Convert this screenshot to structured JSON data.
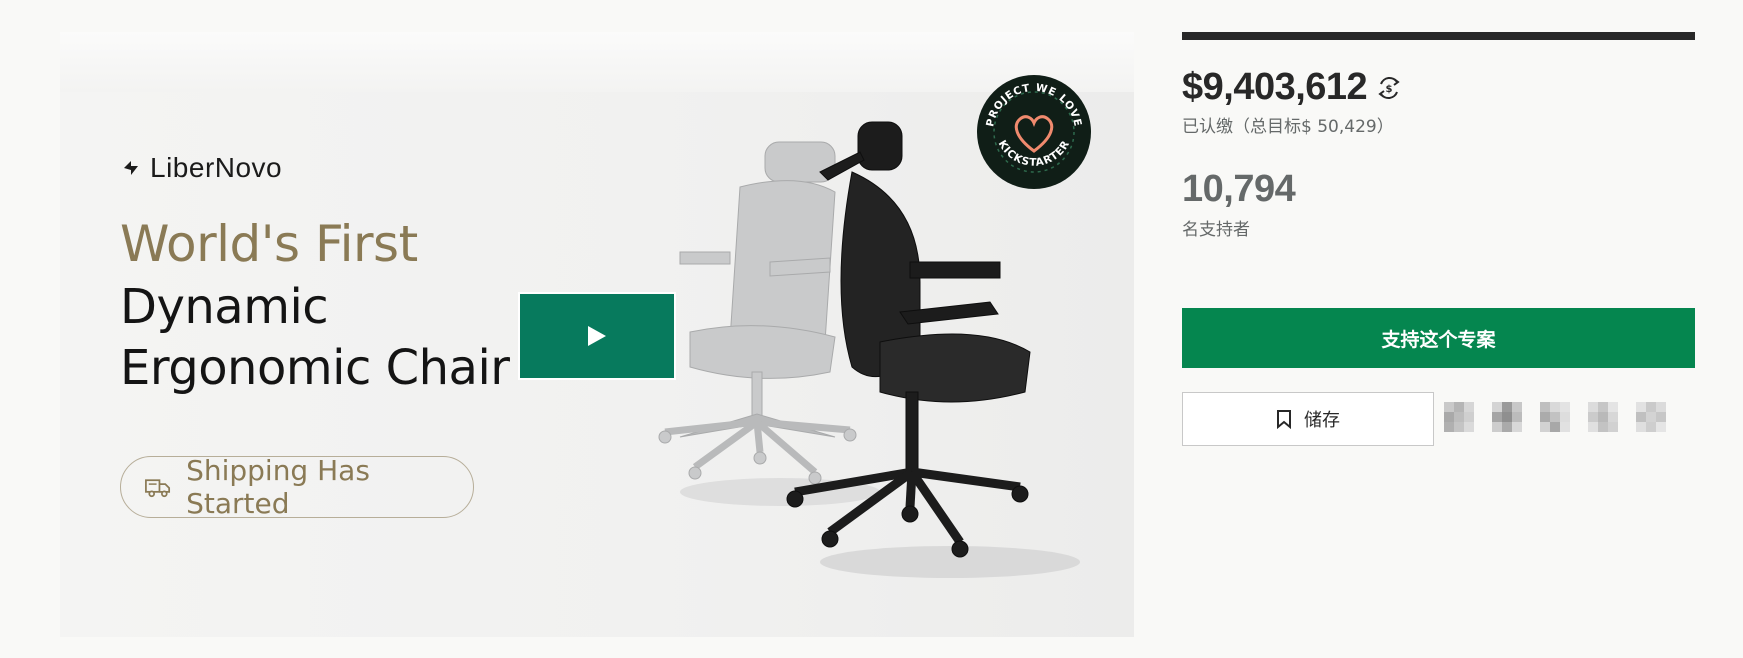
{
  "colors": {
    "accent_green": "#05864f",
    "video_green": "#077a5d",
    "dark_text": "#282828",
    "muted_text": "#656969",
    "gold": "#8a7a55"
  },
  "media": {
    "brand_name": "LiberNovo",
    "headline_line1": "World's First",
    "headline_line2": "Dynamic",
    "headline_line3": "Ergonomic Chair",
    "shipping_badge": "Shipping Has Started",
    "play_icon": "play-icon",
    "badge_label_top": "PROJECT WE LOVE",
    "badge_label_bottom": "KICKSTARTER"
  },
  "campaign": {
    "progress_fraction": 1.0,
    "pledged_amount": "$9,403,612",
    "pledged_label": "已认缴（总目标$ 50,429）",
    "backers_count": "10,794",
    "backers_label": "名支持者",
    "back_button_label": "支持这个专案",
    "save_button_label": "储存",
    "share_icons": [
      "share-icon-1",
      "share-icon-2",
      "share-icon-3",
      "share-icon-4",
      "share-icon-5"
    ]
  }
}
